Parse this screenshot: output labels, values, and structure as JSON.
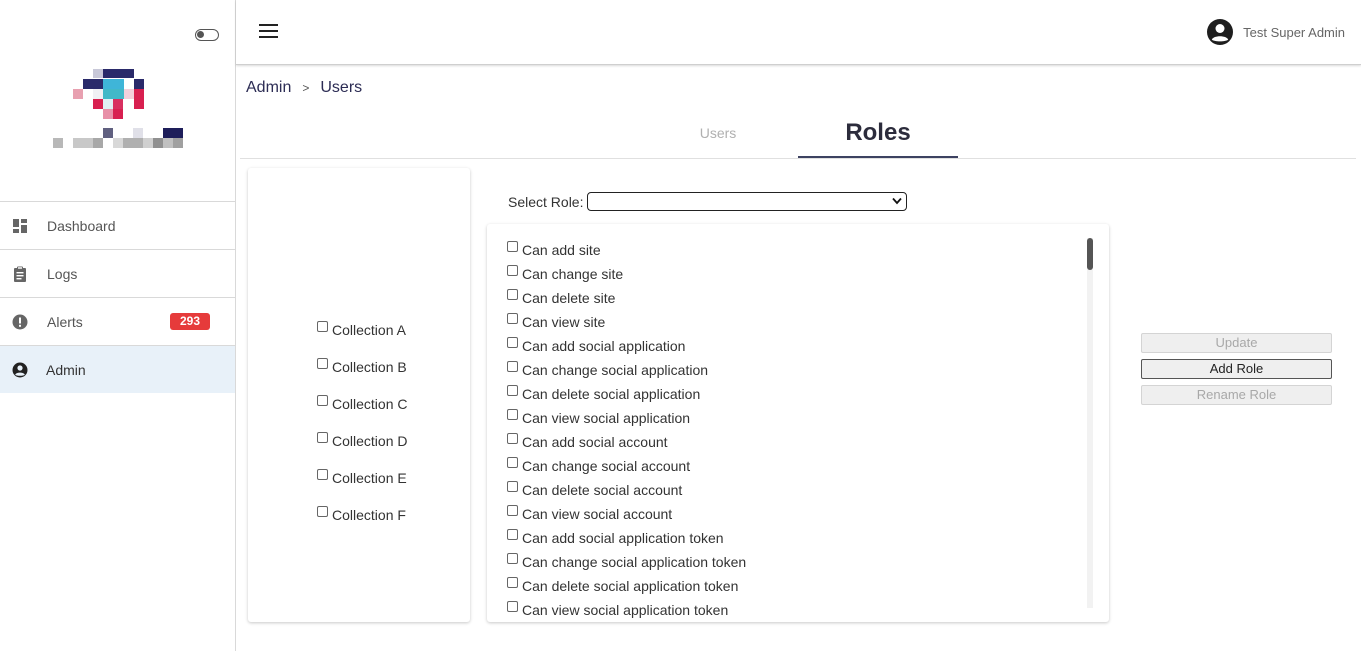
{
  "header": {
    "user_name": "Test Super Admin"
  },
  "sidebar": {
    "items": [
      {
        "label": "Dashboard",
        "icon": "dashboard-icon"
      },
      {
        "label": "Logs",
        "icon": "clipboard-icon"
      },
      {
        "label": "Alerts",
        "icon": "alert-icon",
        "badge": "293"
      },
      {
        "label": "Admin",
        "icon": "account-circle-icon"
      }
    ]
  },
  "breadcrumb": {
    "root": "Admin",
    "separator": ">",
    "current": "Users"
  },
  "tabs": {
    "users": "Users",
    "roles": "Roles",
    "active": "Roles"
  },
  "collections": [
    "Collection A",
    "Collection B",
    "Collection C",
    "Collection D",
    "Collection E",
    "Collection F"
  ],
  "role_select": {
    "label": "Select Role:",
    "value": ""
  },
  "permissions": [
    "Can add site",
    "Can change site",
    "Can delete site",
    "Can view site",
    "Can add social application",
    "Can change social application",
    "Can delete social application",
    "Can view social application",
    "Can add social account",
    "Can change social account",
    "Can delete social account",
    "Can view social account",
    "Can add social application token",
    "Can change social application token",
    "Can delete social application token",
    "Can view social application token"
  ],
  "buttons": {
    "update": "Update",
    "add_role": "Add Role",
    "rename_role": "Rename Role"
  },
  "colors": {
    "badge": "#e63b3b",
    "active_nav": "#e8f1f9",
    "tab_underline": "#3d4261"
  }
}
